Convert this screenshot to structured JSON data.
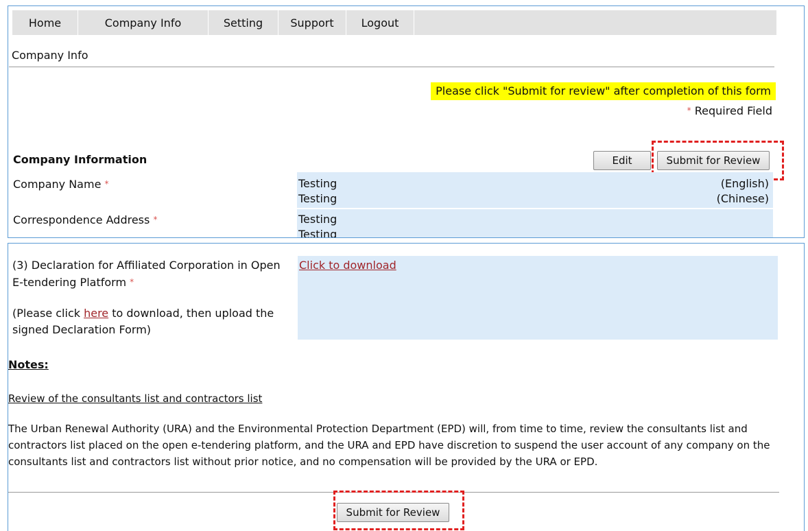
{
  "nav": {
    "items": [
      {
        "label": "Home"
      },
      {
        "label": "Company Info"
      },
      {
        "label": "Setting"
      },
      {
        "label": "Support"
      },
      {
        "label": "Logout"
      }
    ]
  },
  "page_title": "Company Info",
  "notice": "Please click \"Submit for review\" after completion of this form",
  "required": {
    "star": "*",
    "text": "Required Field"
  },
  "company_info": {
    "heading": "Company Information",
    "edit_label": "Edit",
    "submit_label": "Submit for Review",
    "fields": {
      "company_name": {
        "label": "Company Name",
        "english_value": "Testing",
        "english_tag": "(English)",
        "chinese_value": "Testing",
        "chinese_tag": "(Chinese)"
      },
      "address": {
        "label": "Correspondence Address",
        "line1": "Testing",
        "line2": "Testing"
      }
    }
  },
  "declaration": {
    "label": "(3) Declaration for Affiliated Corporation in Open E-tendering Platform",
    "note_prefix": "(Please click ",
    "note_link": "here",
    "note_suffix": " to download, then upload the signed Declaration Form)",
    "download_link": "Click to download"
  },
  "notes": {
    "heading": "Notes:",
    "subheading": "Review of the consultants list and contractors list",
    "body": "The Urban Renewal Authority (URA) and the Environmental Protection Department (EPD) will, from time to time, review the consultants list and contractors list placed on the open e-tendering platform, and the URA and EPD have discretion to suspend the user account of any company on the consultants list and contractors list without prior notice, and no compensation will be provided by the URA or EPD."
  },
  "bottom_submit_label": "Submit for Review",
  "colors": {
    "accent_border": "#5b9bd5",
    "notice_bg": "#ffff00",
    "value_bg": "#dcebf9",
    "required_star": "#d9534f",
    "highlight_dash": "#e02020",
    "link": "#a0252a"
  }
}
